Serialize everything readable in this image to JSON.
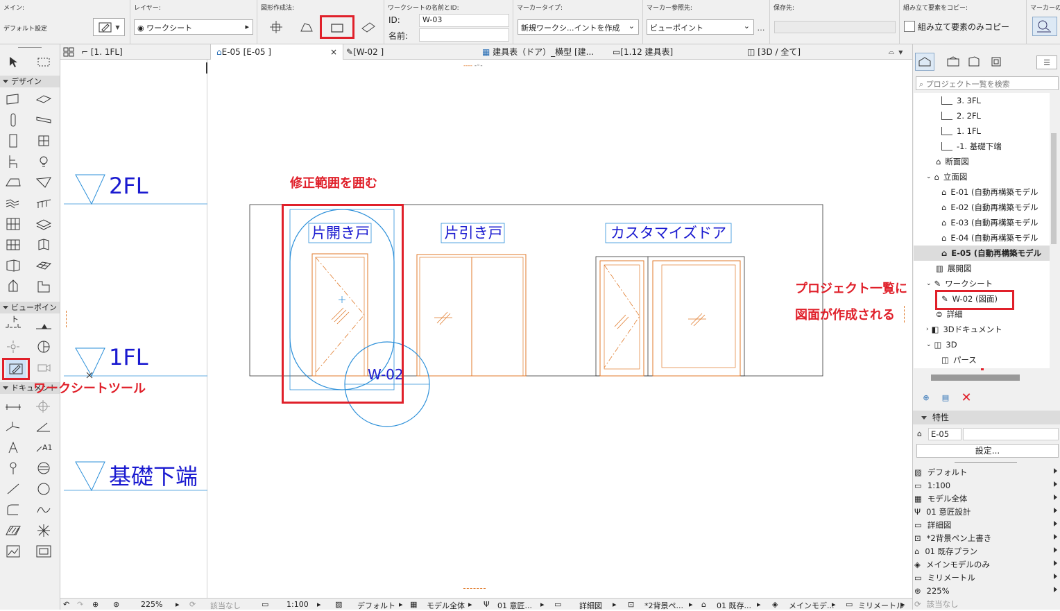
{
  "infobar": {
    "main_label": "メイン:",
    "main_value": "デフォルト設定",
    "layer_label": "レイヤー:",
    "layer_value": "ワークシート",
    "geometry_label": "図形作成法:",
    "name_id_label": "ワークシートの名前とID:",
    "id_label": "ID:",
    "id_value": "W-03",
    "name_label": "名前:",
    "name_value": "",
    "marker_type_label": "マーカータイプ:",
    "marker_type_value": "新規ワークシ...イントを作成",
    "marker_ref_label": "マーカー参照先:",
    "marker_ref_value": "ビューポイント",
    "save_to_label": "保存先:",
    "copy_label": "組み立て要素をコピー:",
    "copy_checkbox": "組み立て要素のみコピー",
    "marker_label": "マーカーの"
  },
  "toolbox": {
    "design_header": "デザイン",
    "viewpoint_header": "ビューポイント",
    "document_header": "ドキュメント"
  },
  "tabs": [
    {
      "label": "[1. 1FL]"
    },
    {
      "label": "E-05 [E-05 ]"
    },
    {
      "label": "[W-02 ]"
    },
    {
      "label": "建具表（ドア）_横型 [建..."
    },
    {
      "label": "[1.12 建具表]"
    },
    {
      "label": "[3D / 全て]"
    }
  ],
  "levels": [
    {
      "label": "2FL"
    },
    {
      "label": "1FL"
    },
    {
      "label": "基礎下端"
    }
  ],
  "drawing": {
    "door_labels": [
      "片開き戸",
      "片引き戸",
      "カスタマイズドア"
    ],
    "worksheet_marker": "W-02",
    "line_color": "#2b8fd9",
    "door_color": "#e07a2a",
    "text_color": "#1a1ad0"
  },
  "annotations": {
    "enclose_range": "修正範囲を囲む",
    "worksheet_tool": "ワークシートツール",
    "project_list_line1": "プロジェクト一覧に",
    "project_list_line2": "図面が作成される",
    "accent": "#e0202a"
  },
  "status": {
    "undo": "",
    "zoom": "225%",
    "none": "該当なし",
    "scale": "1:100",
    "structure": "デフォルト",
    "model": "モデル全体",
    "design": "01 意匠...",
    "detail": "詳細図",
    "pen": "*2背景ペ...",
    "plan": "01 既存...",
    "main_model": "メインモデ...",
    "unit": "ミリメートル"
  },
  "navigator": {
    "search_placeholder": "プロジェクト一覧を検索",
    "items": [
      {
        "label": "3. 3FL"
      },
      {
        "label": "2. 2FL"
      },
      {
        "label": "1. 1FL"
      },
      {
        "label": "-1. 基礎下端"
      },
      {
        "label": "断面図"
      },
      {
        "label": "立面図"
      },
      {
        "label": "E-01 (自動再構築モデル"
      },
      {
        "label": "E-02 (自動再構築モデル"
      },
      {
        "label": "E-03 (自動再構築モデル"
      },
      {
        "label": "E-04 (自動再構築モデル"
      },
      {
        "label": "E-05 (自動再構築モデル"
      },
      {
        "label": "展開図"
      },
      {
        "label": "ワークシート"
      },
      {
        "label": "W-02 (図面)"
      },
      {
        "label": "詳細"
      },
      {
        "label": "3Dドキュメント"
      },
      {
        "label": "3D"
      },
      {
        "label": "パース"
      }
    ]
  },
  "properties": {
    "header": "特性",
    "id_value": "E-05",
    "settings_button": "設定...",
    "rows": [
      {
        "label": "デフォルト"
      },
      {
        "label": "1:100"
      },
      {
        "label": "モデル全体"
      },
      {
        "label": "01 意匠設計"
      },
      {
        "label": "詳細図"
      },
      {
        "label": "*2背景ペン上書き"
      },
      {
        "label": "01 既存プラン"
      },
      {
        "label": "メインモデルのみ"
      },
      {
        "label": "ミリメートル"
      },
      {
        "label": "225%"
      },
      {
        "label": "該当なし"
      }
    ]
  }
}
